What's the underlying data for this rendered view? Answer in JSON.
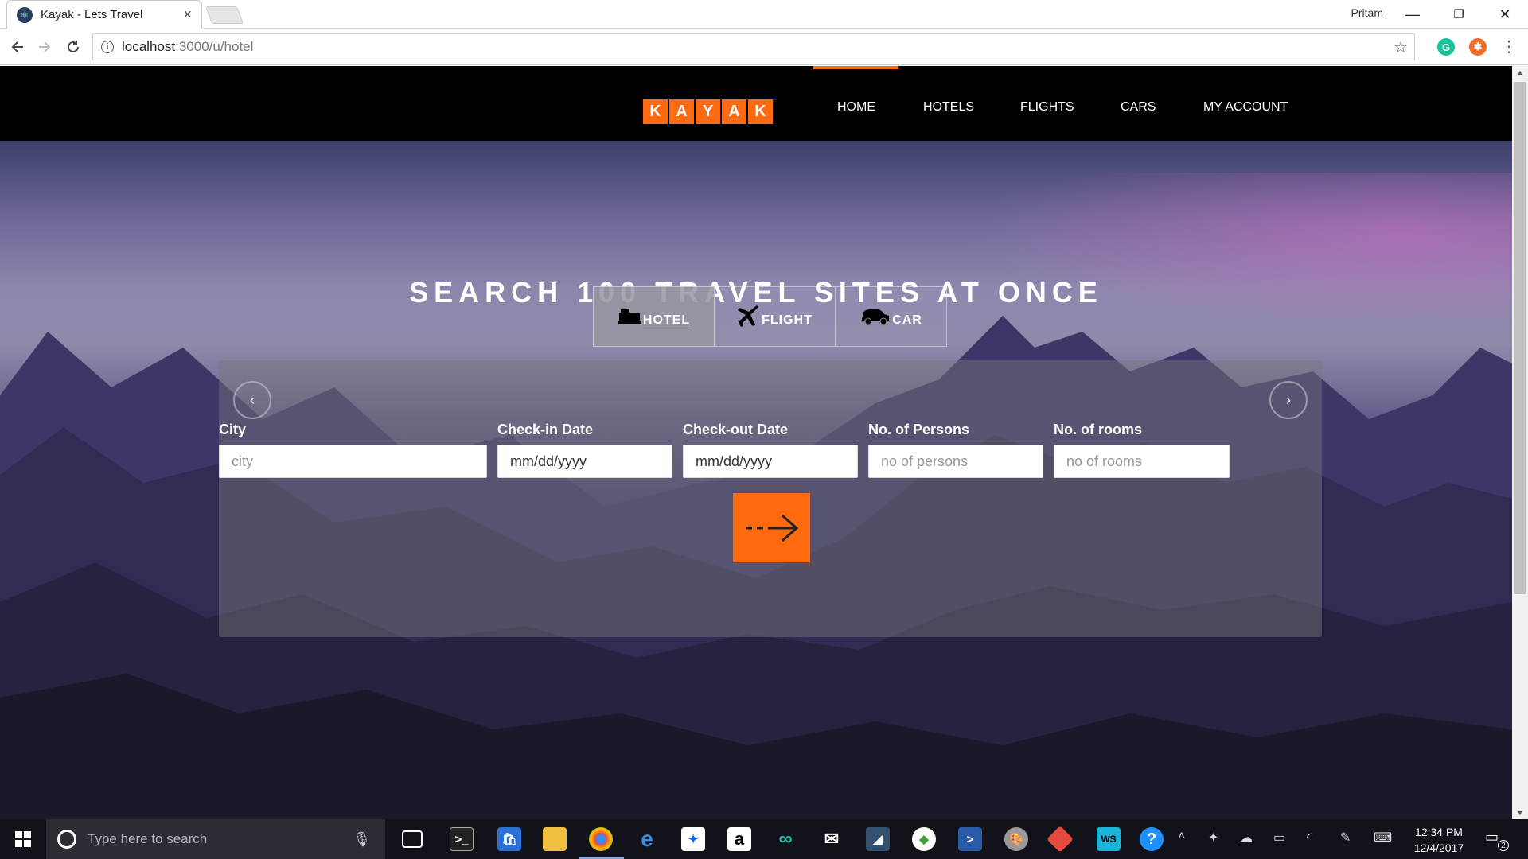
{
  "browser": {
    "tab_title": "Kayak - Lets Travel",
    "tab_close": "×",
    "user_name": "Pritam",
    "url_host": "localhost",
    "url_path": ":3000/u/hotel",
    "minimize": "—",
    "restore": "❐",
    "close": "✕"
  },
  "navbar": {
    "logo_letters": [
      "K",
      "A",
      "Y",
      "A",
      "K"
    ],
    "links": [
      "HOME",
      "HOTELS",
      "FLIGHTS",
      "CARS",
      "MY ACCOUNT"
    ],
    "active_link": "HOME",
    "accent_color": "#ff690f"
  },
  "hero": {
    "headline": "SEARCH 100 TRAVEL SITES AT ONCE"
  },
  "mode_tabs": [
    {
      "label": "HOTEL",
      "icon": "bed-icon",
      "active": true
    },
    {
      "label": "FLIGHT",
      "icon": "airplane-icon",
      "active": false
    },
    {
      "label": "CAR",
      "icon": "car-icon",
      "active": false
    }
  ],
  "search_form": {
    "prev_glyph": "‹",
    "next_glyph": "›",
    "fields": [
      {
        "label": "City",
        "placeholder": "city"
      },
      {
        "label": "Check-in Date",
        "placeholder": "mm/dd/yyyy"
      },
      {
        "label": "Check-out Date",
        "placeholder": "mm/dd/yyyy"
      },
      {
        "label": "No. of Persons",
        "placeholder": "no of persons"
      },
      {
        "label": "No. of rooms",
        "placeholder": "no of rooms"
      }
    ],
    "submit_icon": "arrow-right-icon"
  },
  "taskbar": {
    "search_placeholder": "Type here to search",
    "time": "12:34 PM",
    "date": "12/4/2017",
    "notification_count": "2"
  }
}
